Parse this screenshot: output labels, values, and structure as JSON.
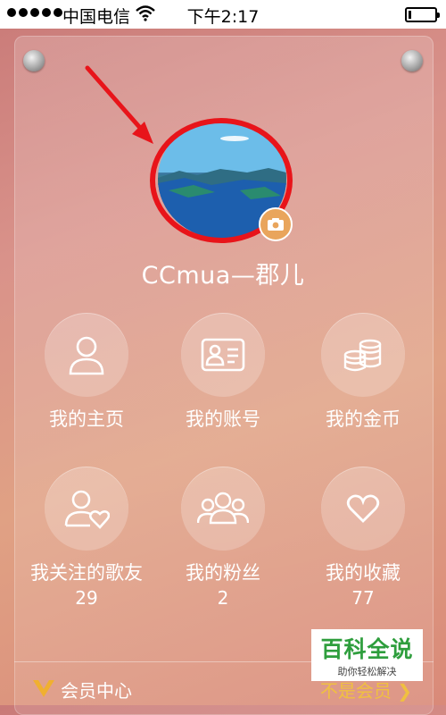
{
  "status_bar": {
    "carrier": "中国电信",
    "time": "下午2:17",
    "battery_level": 0.1
  },
  "profile": {
    "username": "CCmua—郡儿"
  },
  "grid": [
    {
      "label": "我的主页",
      "icon": "person-icon"
    },
    {
      "label": "我的账号",
      "icon": "id-card-icon"
    },
    {
      "label": "我的金币",
      "icon": "coins-icon"
    },
    {
      "label": "我关注的歌友",
      "count": "29",
      "icon": "person-heart-icon"
    },
    {
      "label": "我的粉丝",
      "count": "2",
      "icon": "group-icon"
    },
    {
      "label": "我的收藏",
      "count": "77",
      "icon": "heart-icon"
    }
  ],
  "footer": {
    "vip_label": "会员中心",
    "vip_status": "不是会员 ❯"
  },
  "watermark": {
    "title": "百科全说",
    "subtitle": "助你轻松解决"
  },
  "colors": {
    "highlight_ring": "#e8141a",
    "vip_status": "#f0c040",
    "watermark_green": "#2e9e3d"
  }
}
